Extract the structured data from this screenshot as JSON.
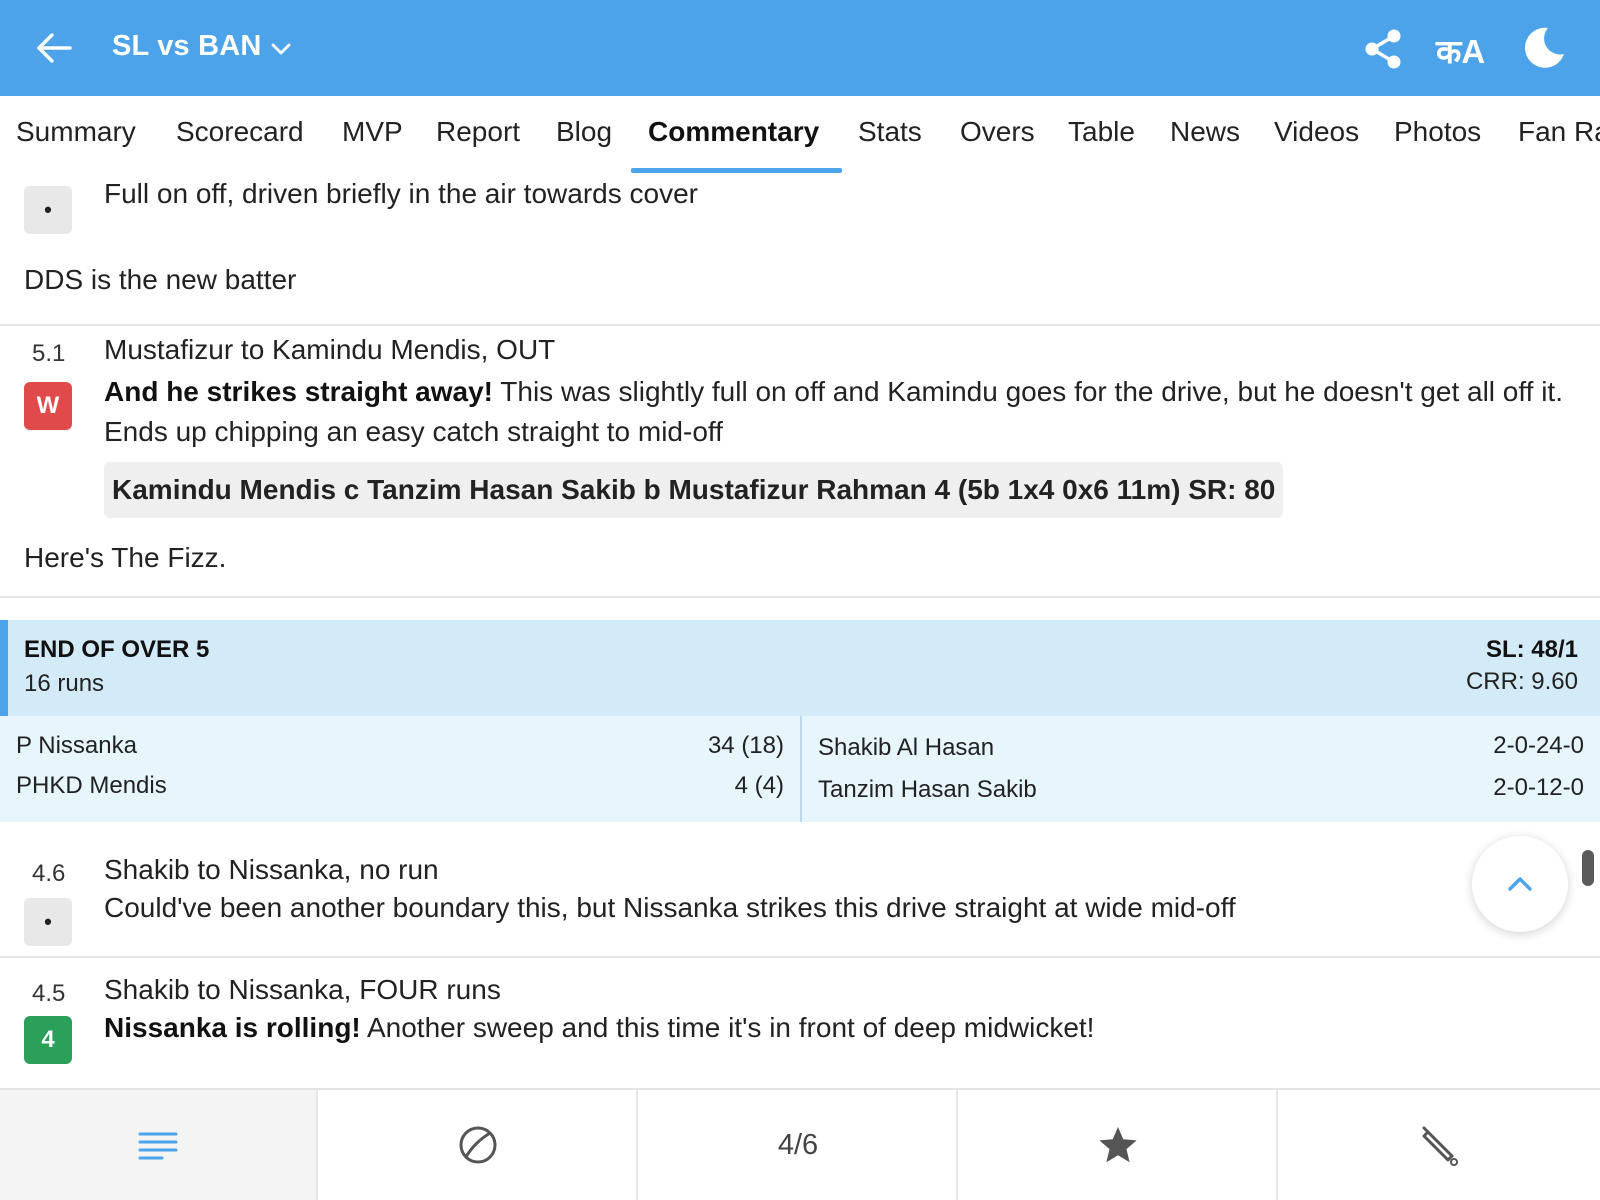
{
  "header": {
    "title": "SL vs BAN",
    "lang_label": "कA",
    "icons": {
      "back": "arrow-left-icon",
      "dropdown": "chevron-down-icon",
      "share": "share-icon",
      "language": "language-icon",
      "theme": "moon-icon"
    },
    "color": "#4da3ea"
  },
  "tabs": [
    {
      "label": "Summary"
    },
    {
      "label": "Scorecard"
    },
    {
      "label": "MVP"
    },
    {
      "label": "Report"
    },
    {
      "label": "Blog"
    },
    {
      "label": "Commentary",
      "active": true
    },
    {
      "label": "Stats"
    },
    {
      "label": "Overs"
    },
    {
      "label": "Table"
    },
    {
      "label": "News"
    },
    {
      "label": "Videos"
    },
    {
      "label": "Photos"
    },
    {
      "label": "Fan Ra"
    }
  ],
  "feed": {
    "ball_a": {
      "badge": "•",
      "text": "Full on off, driven briefly in the air towards cover"
    },
    "note_1": "DDS is the new batter",
    "ball_b": {
      "over": "5.1",
      "badge": "W",
      "headline": "Mustafizur to Kamindu Mendis, OUT",
      "bold": "And he strikes straight away!",
      "text": " This was slightly full on off and Kamindu goes for the drive, but he doesn't get all off it. Ends up chipping an easy catch straight to mid-off",
      "dismissal": "Kamindu Mendis c Tanzim Hasan Sakib b Mustafizur Rahman 4 (5b 1x4 0x6 11m) SR: 80"
    },
    "note_2": "Here's The Fizz.",
    "end_of_over": {
      "title": "END OF OVER 5",
      "runs": "16 runs",
      "score": "SL: 48/1",
      "crr": "CRR: 9.60",
      "batters": [
        {
          "name": "P Nissanka",
          "score": "34 (18)"
        },
        {
          "name": "PHKD Mendis",
          "score": "4 (4)"
        }
      ],
      "bowlers": [
        {
          "name": "Shakib Al Hasan",
          "figures": "2-0-24-0"
        },
        {
          "name": "Tanzim Hasan Sakib",
          "figures": "2-0-12-0"
        }
      ]
    },
    "ball_c": {
      "over": "4.6",
      "badge": "•",
      "headline": "Shakib to Nissanka, no run",
      "text": "Could've been another boundary this, but Nissanka strikes this drive straight at wide mid-off"
    },
    "ball_d": {
      "over": "4.5",
      "badge": "4",
      "headline": "Shakib to Nissanka, FOUR runs",
      "bold": "Nissanka is rolling!",
      "text": " Another sweep and this time it's in front of deep midwicket!"
    }
  },
  "bottom_bar": {
    "items": [
      {
        "icon": "menu-lines-icon"
      },
      {
        "icon": "cricket-ball-icon"
      },
      {
        "label": "4/6"
      },
      {
        "icon": "star-icon"
      },
      {
        "icon": "cricket-bat-icon"
      }
    ]
  },
  "scroll_top_icon": "chevron-up-icon"
}
